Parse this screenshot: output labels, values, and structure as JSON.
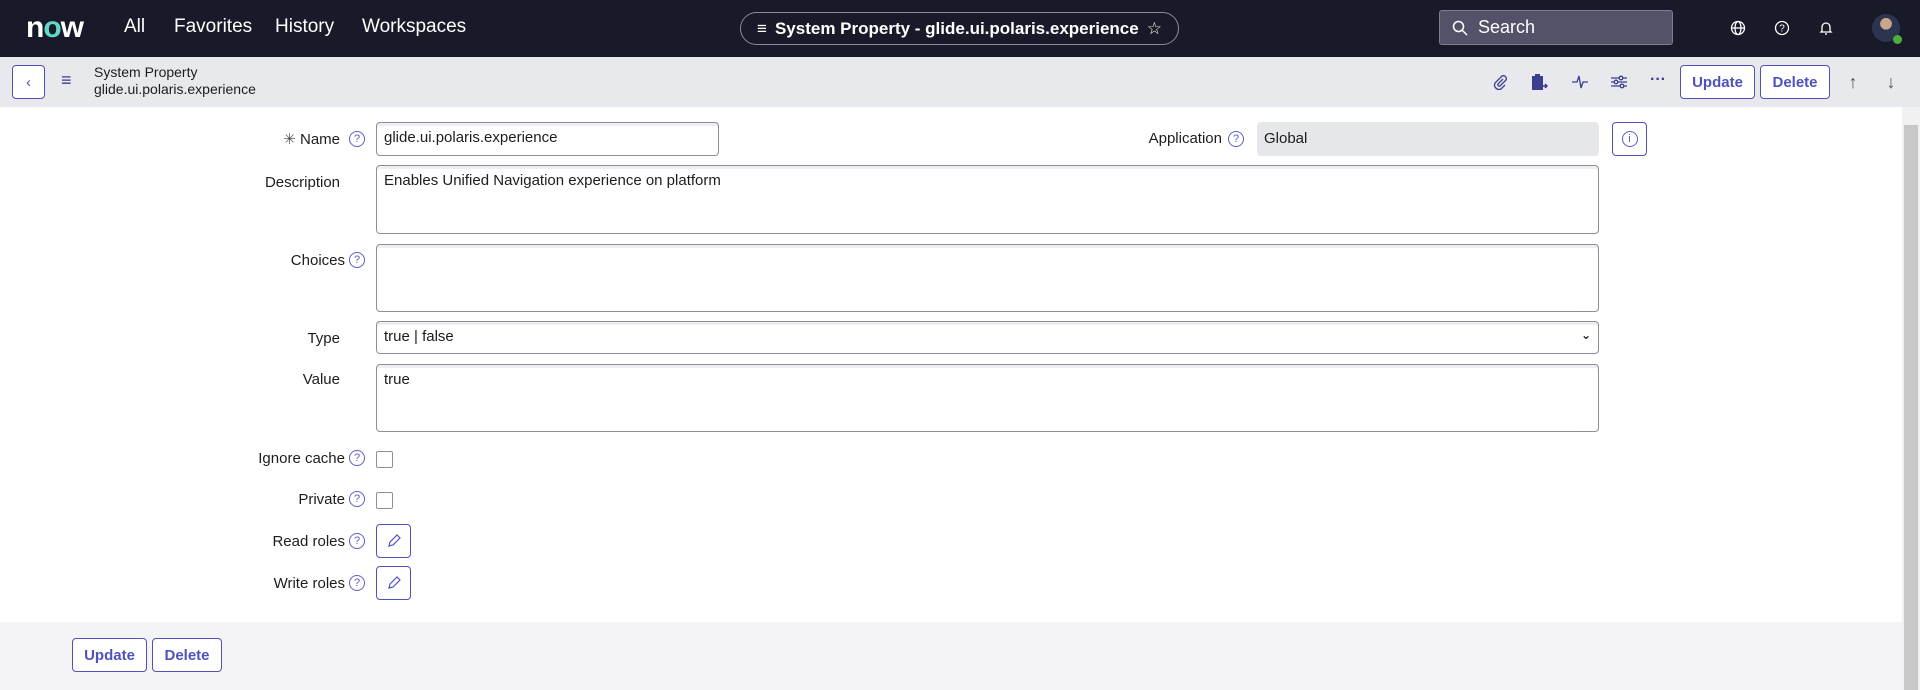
{
  "topbar": {
    "logo": "now",
    "nav": [
      "All",
      "Favorites",
      "History",
      "Workspaces"
    ],
    "pill_title": "System Property - glide.ui.polaris.experience",
    "search_placeholder": "Search"
  },
  "subbar": {
    "record_type": "System Property",
    "record_name": "glide.ui.polaris.experience",
    "update_label": "Update",
    "delete_label": "Delete"
  },
  "form": {
    "name": {
      "label": "Name",
      "value": "glide.ui.polaris.experience"
    },
    "application": {
      "label": "Application",
      "value": "Global"
    },
    "description": {
      "label": "Description",
      "value": "Enables Unified Navigation experience on platform"
    },
    "choices": {
      "label": "Choices",
      "value": ""
    },
    "type": {
      "label": "Type",
      "value": "true | false"
    },
    "value": {
      "label": "Value",
      "value": "true"
    },
    "ignore_cache": {
      "label": "Ignore cache",
      "checked": false
    },
    "private": {
      "label": "Private",
      "checked": false
    },
    "read_roles": {
      "label": "Read roles"
    },
    "write_roles": {
      "label": "Write roles"
    }
  },
  "footer": {
    "update_label": "Update",
    "delete_label": "Delete"
  },
  "colors": {
    "accent": "#4f52bd",
    "topbar": "#181a29"
  }
}
